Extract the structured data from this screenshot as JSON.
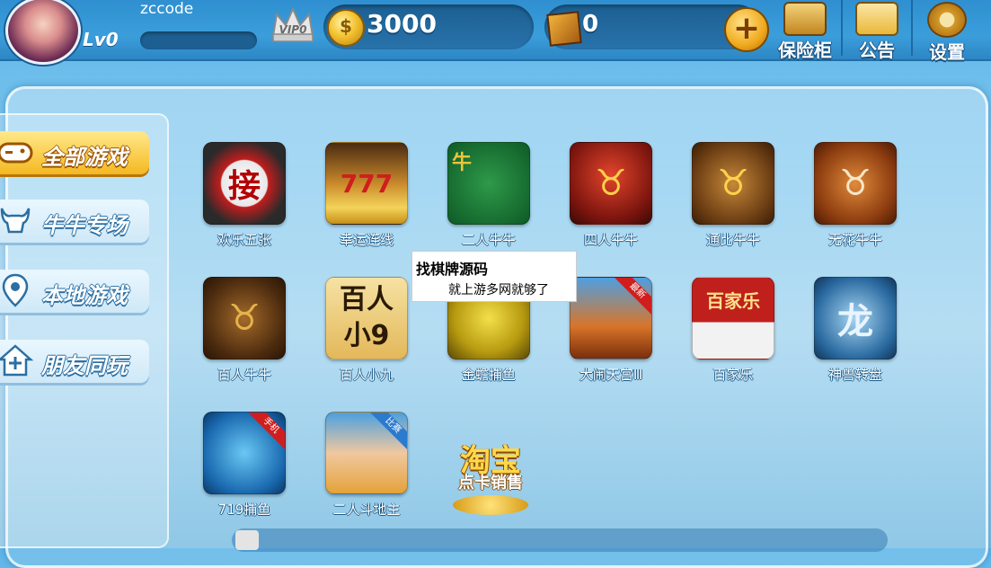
{
  "player": {
    "username": "zccode",
    "level": "Lv0",
    "vip": "VIP0"
  },
  "currency": {
    "coins": "3000",
    "gems": "0",
    "coin_symbol": "$"
  },
  "top_buttons": [
    {
      "label": "保险柜",
      "icon": "safe-icon"
    },
    {
      "label": "公告",
      "icon": "mail-icon"
    },
    {
      "label": "设置",
      "icon": "gear-icon"
    }
  ],
  "nav": [
    {
      "label": "全部游戏",
      "icon": "gamepad-icon",
      "active": true
    },
    {
      "label": "牛牛专场",
      "icon": "bull-icon",
      "active": false
    },
    {
      "label": "本地游戏",
      "icon": "location-pin-icon",
      "active": false
    },
    {
      "label": "朋友同玩",
      "icon": "house-plus-icon",
      "active": false
    }
  ],
  "games": [
    {
      "name": "欢乐五张",
      "glyph": "接",
      "tag": ""
    },
    {
      "name": "幸运连线",
      "glyph": "777",
      "tag": ""
    },
    {
      "name": "二人牛牛",
      "glyph": "牛",
      "tag": ""
    },
    {
      "name": "四人牛牛",
      "glyph": "♉",
      "tag": ""
    },
    {
      "name": "通比牛牛",
      "glyph": "♉",
      "tag": ""
    },
    {
      "name": "无花牛牛",
      "glyph": "♉",
      "tag": ""
    },
    {
      "name": "百人牛牛",
      "glyph": "♉",
      "tag": ""
    },
    {
      "name": "百人小九",
      "glyph": "百人小9",
      "tag": ""
    },
    {
      "name": "金蟾捕鱼",
      "glyph": "",
      "tag": ""
    },
    {
      "name": "大闹天宫Ⅲ",
      "glyph": "",
      "tag": "最新"
    },
    {
      "name": "百家乐",
      "glyph": "百家乐",
      "tag": ""
    },
    {
      "name": "神兽转盘",
      "glyph": "龙",
      "tag": ""
    },
    {
      "name": "719捕鱼",
      "glyph": "",
      "tag": "手机"
    },
    {
      "name": "二人斗地主",
      "glyph": "",
      "tag": "比赛"
    }
  ],
  "promo": {
    "title": "淘宝",
    "subtitle": "点卡销售"
  },
  "popup": {
    "line1": "找棋牌源码",
    "line2": "就上游多网就够了"
  },
  "colors": {
    "gold": "#f4b821",
    "sky": "#7cc6ee"
  }
}
